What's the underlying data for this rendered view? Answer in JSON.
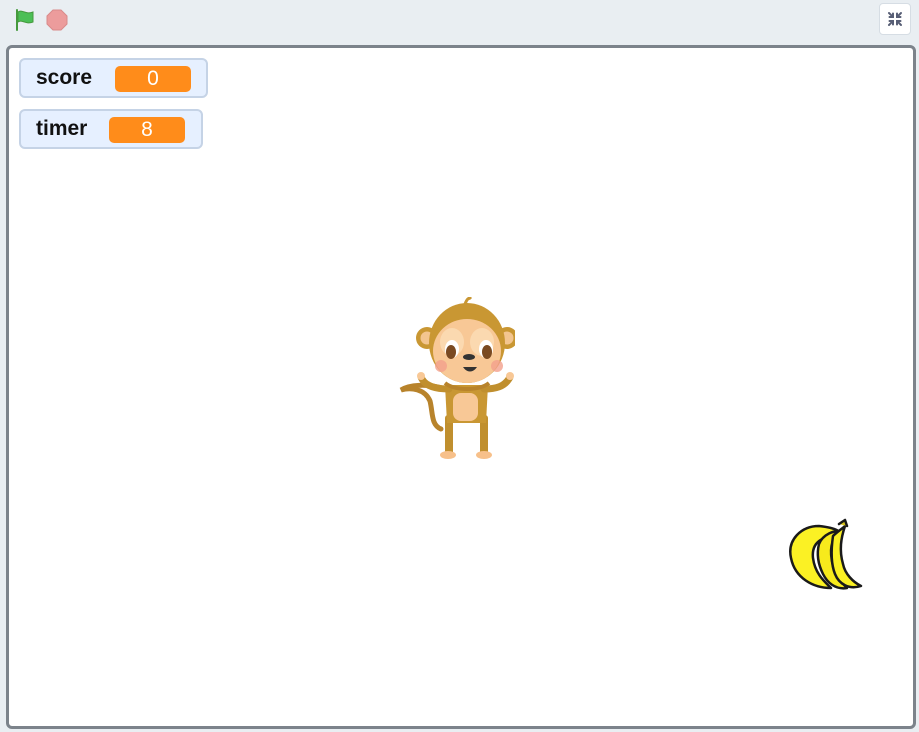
{
  "toolbar": {
    "green_flag_icon": "green-flag-icon",
    "stop_icon": "stop-sign-icon",
    "fullscreen_icon": "unfullscreen-icon"
  },
  "monitors": {
    "score": {
      "label": "score",
      "value": "0"
    },
    "timer": {
      "label": "timer",
      "value": "8"
    }
  },
  "sprites": [
    {
      "name": "monkey"
    },
    {
      "name": "bananas"
    }
  ],
  "colors": {
    "monitor_value_bg": "#ff8c1a",
    "monitor_bg": "#e6f0ff",
    "stage_border": "#7c838b",
    "flag_green": "#4cbf56",
    "stop_red": "#ec9c9c"
  }
}
